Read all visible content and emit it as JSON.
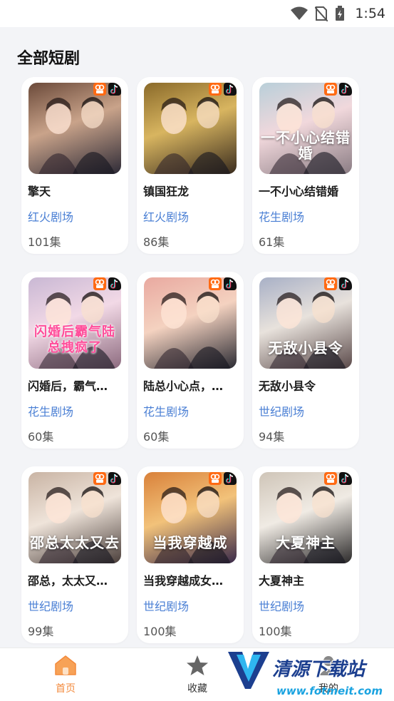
{
  "status_bar": {
    "time": "1:54"
  },
  "section": {
    "title": "全部短剧"
  },
  "dramas": [
    {
      "title": "擎天",
      "source": "红火剧场",
      "episodes": "101集",
      "cover_text": "",
      "cover_colors": [
        "#6b4a3a",
        "#c9a38a",
        "#2d2a36"
      ]
    },
    {
      "title": "镇国狂龙",
      "source": "红火剧场",
      "episodes": "86集",
      "cover_text": "",
      "cover_colors": [
        "#8a6a2a",
        "#d8b560",
        "#3a2c1e"
      ]
    },
    {
      "title": "一不小心结错婚",
      "source": "花生剧场",
      "episodes": "61集",
      "cover_text": "一不小心结错婚",
      "cover_colors": [
        "#b9cfd9",
        "#f1d8dc",
        "#8b7d84"
      ]
    },
    {
      "title": "闪婚后，霸气…",
      "source": "花生剧场",
      "episodes": "60集",
      "cover_text": "闪婚后霸气陆总拽疯了",
      "cover_colors": [
        "#c9b8d4",
        "#f2d9e6",
        "#8d6b7f"
      ]
    },
    {
      "title": "陆总小心点，…",
      "source": "花生剧场",
      "episodes": "60集",
      "cover_text": "",
      "cover_colors": [
        "#e9a9a0",
        "#f4d2c0",
        "#2b2b33"
      ]
    },
    {
      "title": "无敌小县令",
      "source": "世纪剧场",
      "episodes": "94集",
      "cover_text": "无敌小县令",
      "cover_colors": [
        "#a8b0c6",
        "#e8e2dc",
        "#5b4a4a"
      ]
    },
    {
      "title": "邵总，太太又…",
      "source": "世纪剧场",
      "episodes": "99集",
      "cover_text": "邵总太太又去",
      "cover_colors": [
        "#c9b4a4",
        "#efe4da",
        "#4a3e3a"
      ]
    },
    {
      "title": "当我穿越成女…",
      "source": "世纪剧场",
      "episodes": "100集",
      "cover_text": "当我穿越成",
      "cover_colors": [
        "#d9813a",
        "#f2c27a",
        "#3a2a4a"
      ]
    },
    {
      "title": "大夏神主",
      "source": "世纪剧场",
      "episodes": "100集",
      "cover_text": "大夏神主",
      "cover_colors": [
        "#cfc5b8",
        "#f0ebe4",
        "#2c2a2a"
      ]
    }
  ],
  "nav": {
    "home": "首页",
    "favorites": "收藏",
    "mine": "我的"
  },
  "watermark": {
    "title": "清源下载站",
    "url": "www.fotmeit.com"
  },
  "colors": {
    "accent": "#f38a3c",
    "source_link": "#4a7fd4"
  }
}
